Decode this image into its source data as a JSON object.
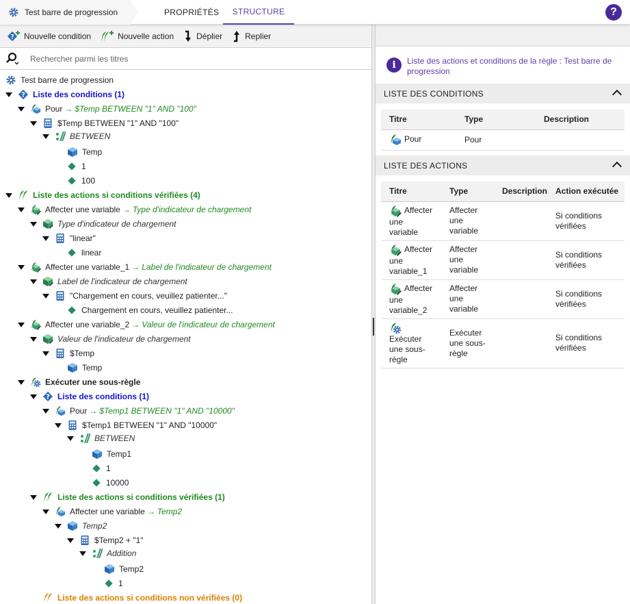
{
  "header": {
    "breadcrumb_title": "Test barre de progression",
    "tabs": [
      {
        "label": "PROPRIÉTÉS",
        "active": false
      },
      {
        "label": "STRUCTURE",
        "active": true
      }
    ],
    "help_label": "?"
  },
  "toolbar": {
    "new_condition": "Nouvelle condition",
    "new_action": "Nouvelle action",
    "expand": "Déplier",
    "collapse": "Replier"
  },
  "search": {
    "placeholder": "Rechercher parmi les titres"
  },
  "tree": {
    "root": "Test barre de progression",
    "n1": "Liste des conditions (1)",
    "n2": "Pour",
    "n2_target": "$Temp BETWEEN \"1\" AND \"100\"",
    "n3": "$Temp BETWEEN \"1\" AND \"100\"",
    "n4": "BETWEEN",
    "n5": "Temp",
    "n6": "1",
    "n7": "100",
    "n8": "Liste des actions si conditions vérifiées (4)",
    "n9": "Affecter une variable",
    "n9_target": "Type d'indicateur de chargement",
    "n10": "Type d'indicateur de chargement",
    "n11": "\"linear\"",
    "n12": "linear",
    "n13": "Affecter une variable_1",
    "n13_target": "Label de l'indicateur de chargement",
    "n14": "Label de l'indicateur de chargement",
    "n15": "\"Chargement en cours, veuillez patienter...\"",
    "n16": "Chargement en cours, veuillez patienter...",
    "n17": "Affecter une variable_2",
    "n17_target": "Valeur de l'indicateur de chargement",
    "n18": "Valeur de l'indicateur de chargement",
    "n19": "$Temp",
    "n20": "Temp",
    "n21": "Exécuter une sous-règle",
    "n22": "Liste des conditions (1)",
    "n23": "Pour",
    "n23_target": "$Temp1 BETWEEN \"1\" AND \"10000\"",
    "n24": "$Temp1 BETWEEN \"1\" AND \"10000\"",
    "n25": "BETWEEN",
    "n26": "Temp1",
    "n27": "1",
    "n28": "10000",
    "n29": "Liste des actions si conditions vérifiées (1)",
    "n30": "Affecter une variable",
    "n30_target": "Temp2",
    "n31": "Temp2",
    "n32": "$Temp2 + \"1\"",
    "n33": "Addition",
    "n34": "Temp2",
    "n35": "1",
    "n36": "Liste des actions si conditions non vérifiées (0)"
  },
  "right": {
    "info_text": "Liste des actions et conditions de la règle : Test barre de progression",
    "conditions_title": "LISTE DES CONDITIONS",
    "conditions_headers": [
      "Titre",
      "Type",
      "Description"
    ],
    "conditions_rows": [
      {
        "titre": "Pour",
        "type": "Pour",
        "description": ""
      }
    ],
    "actions_title": "LISTE DES ACTIONS",
    "actions_headers": [
      "Titre",
      "Type",
      "Description",
      "Action exécutée"
    ],
    "actions_rows": [
      {
        "titre": "Affecter une variable",
        "type": "Affecter une variable",
        "description": "",
        "executed": "Si conditions vérifiées"
      },
      {
        "titre": "Affecter une variable_1",
        "type": "Affecter une variable",
        "description": "",
        "executed": "Si conditions vérifiées"
      },
      {
        "titre": "Affecter une variable_2",
        "type": "Affecter une variable",
        "description": "",
        "executed": "Si conditions vérifiées"
      },
      {
        "titre": "Exécuter une sous-règle",
        "type": "Exécuter une sous-règle",
        "description": "",
        "executed": "Si conditions vérifiées"
      }
    ]
  },
  "colors": {
    "accent": "#5c3fa4",
    "conditions_blue": "#1515c8",
    "actions_green": "#1f8a1f",
    "actions_else_orange": "#d98000"
  },
  "icons": {
    "rule": "gear-icon",
    "condition_list": "question-diamond-icon",
    "action_list": "double-leaf-icon",
    "variable": "cube-icon",
    "formula": "calculator-icon",
    "operator": "function-icon",
    "value": "diamond-icon",
    "assign": "assign-variable-icon",
    "subrule": "subrule-gear-icon"
  }
}
